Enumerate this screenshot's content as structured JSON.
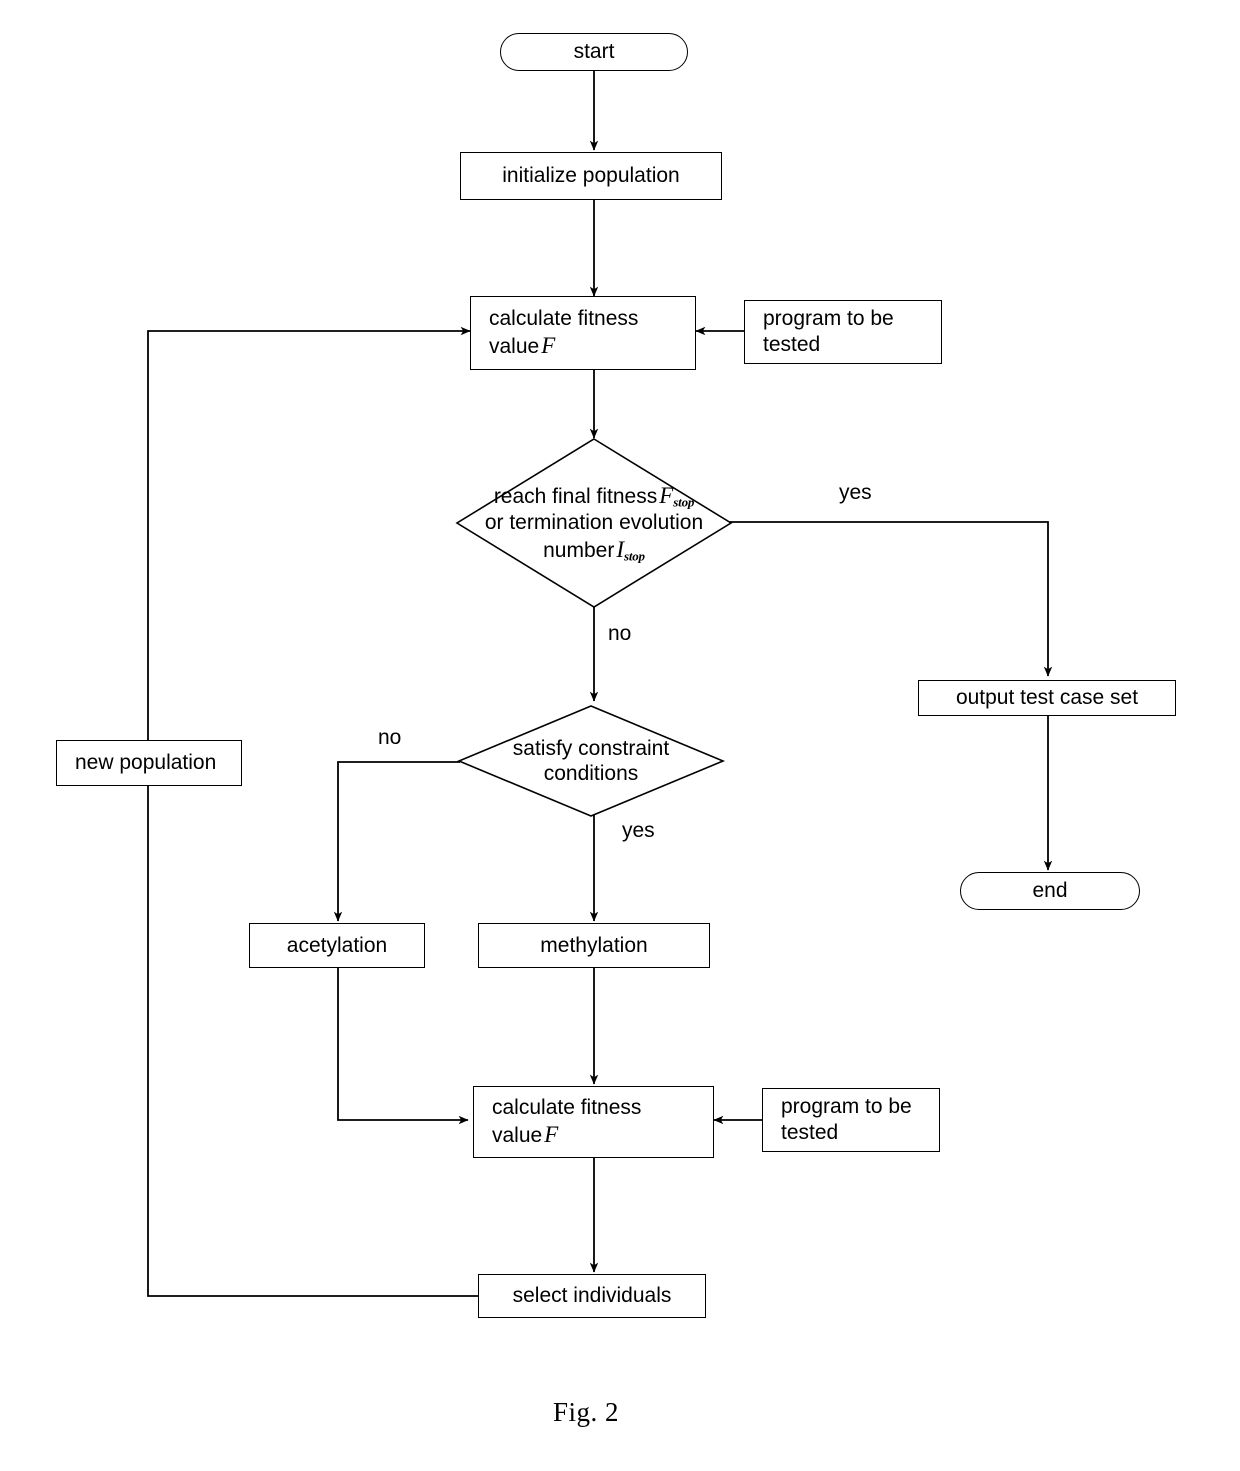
{
  "figure": {
    "caption": "Fig. 2"
  },
  "nodes": {
    "start": {
      "label": "start",
      "shape": "terminal"
    },
    "initialize_population": {
      "label": "initialize population",
      "shape": "process"
    },
    "calculate_fitness_top": {
      "label": "calculate fitness",
      "label_line2": "value",
      "variable": "F",
      "shape": "process"
    },
    "program_to_be_tested_top": {
      "label": "program to be",
      "label_line2": "tested",
      "shape": "process"
    },
    "reach_final_fitness": {
      "line1": "reach final fitness",
      "var1": "F",
      "var1_sub": "stop",
      "line2": "or termination evolution",
      "line3": "number",
      "var2": "I",
      "var2_sub": "stop",
      "shape": "decision"
    },
    "satisfy_constraint": {
      "line1": "satisfy constraint",
      "line2": "conditions",
      "shape": "decision"
    },
    "output_test_case_set": {
      "label": "output test case set",
      "shape": "process"
    },
    "end": {
      "label": "end",
      "shape": "terminal"
    },
    "new_population": {
      "label": "new population",
      "shape": "process"
    },
    "acetylation": {
      "label": "acetylation",
      "shape": "process"
    },
    "methylation": {
      "label": "methylation",
      "shape": "process"
    },
    "calculate_fitness_bottom": {
      "label": "calculate fitness",
      "label_line2": "value",
      "variable": "F",
      "shape": "process"
    },
    "program_to_be_tested_bottom": {
      "label": "program to be",
      "label_line2": "tested",
      "shape": "process"
    },
    "select_individuals": {
      "label": "select individuals",
      "shape": "process"
    }
  },
  "edge_labels": {
    "fitness_yes": "yes",
    "fitness_no": "no",
    "constraint_no": "no",
    "constraint_yes": "yes"
  },
  "colors": {
    "line": "#000000",
    "background": "#ffffff",
    "text": "#000000"
  }
}
